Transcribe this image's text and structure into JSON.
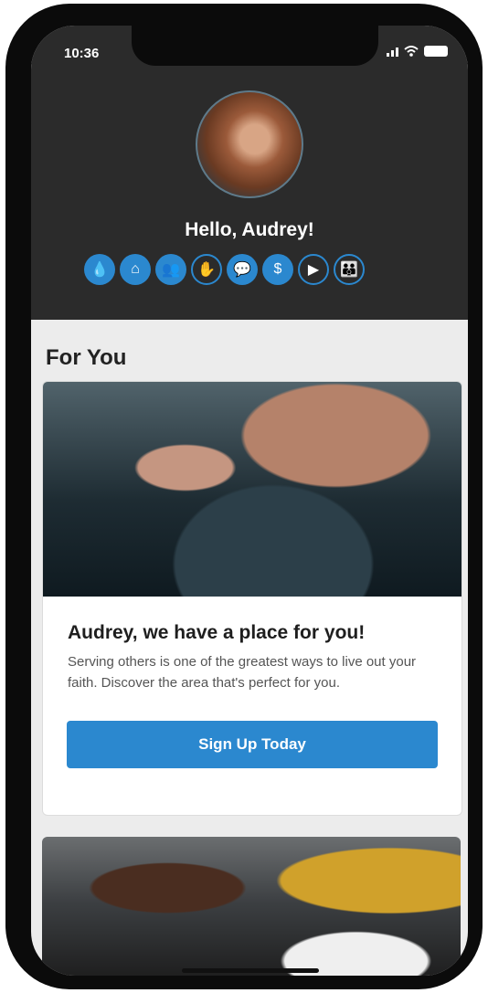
{
  "status": {
    "time": "10:36"
  },
  "profile": {
    "greeting": "Hello, Audrey!"
  },
  "quick_actions": [
    {
      "icon": "water-drop-icon",
      "glyph": "💧",
      "style": "filled"
    },
    {
      "icon": "home-icon",
      "glyph": "⌂",
      "style": "filled"
    },
    {
      "icon": "people-icon",
      "glyph": "👥",
      "style": "filled"
    },
    {
      "icon": "hand-icon",
      "glyph": "✋",
      "style": "outline"
    },
    {
      "icon": "chat-icon",
      "glyph": "💬",
      "style": "filled"
    },
    {
      "icon": "dollar-icon",
      "glyph": "$",
      "style": "filled"
    },
    {
      "icon": "play-icon",
      "glyph": "▶",
      "style": "outline"
    },
    {
      "icon": "group-icon",
      "glyph": "👪",
      "style": "outline"
    }
  ],
  "feed": {
    "section_title": "For You",
    "cards": [
      {
        "title": "Audrey, we have a place for you!",
        "text": "Serving others is one of the greatest ways to live out your faith. Discover the area that's perfect for you.",
        "button_label": "Sign Up Today"
      }
    ]
  },
  "colors": {
    "accent": "#2b88cf",
    "header_bg": "#2b2b2b",
    "page_bg": "#ececec"
  }
}
